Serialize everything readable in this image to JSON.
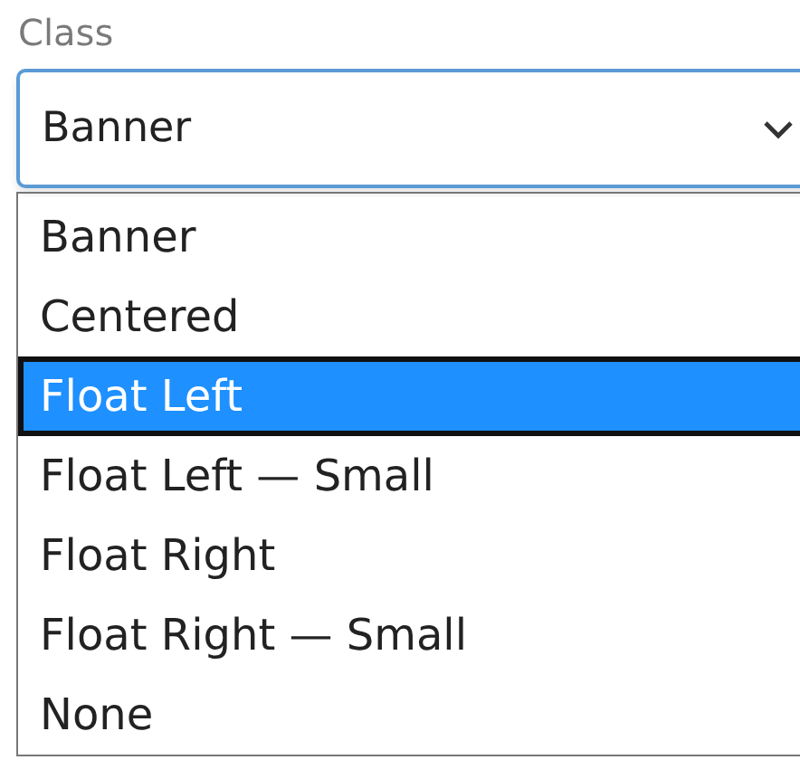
{
  "field": {
    "label": "Class",
    "value": "Banner",
    "expanded": true
  },
  "options": [
    {
      "label": "Banner",
      "selected": false
    },
    {
      "label": "Centered",
      "selected": false
    },
    {
      "label": "Float Left",
      "selected": true
    },
    {
      "label": "Float Left — Small",
      "selected": false
    },
    {
      "label": "Float Right",
      "selected": false
    },
    {
      "label": "Float Right — Small",
      "selected": false
    },
    {
      "label": "None",
      "selected": false
    }
  ]
}
